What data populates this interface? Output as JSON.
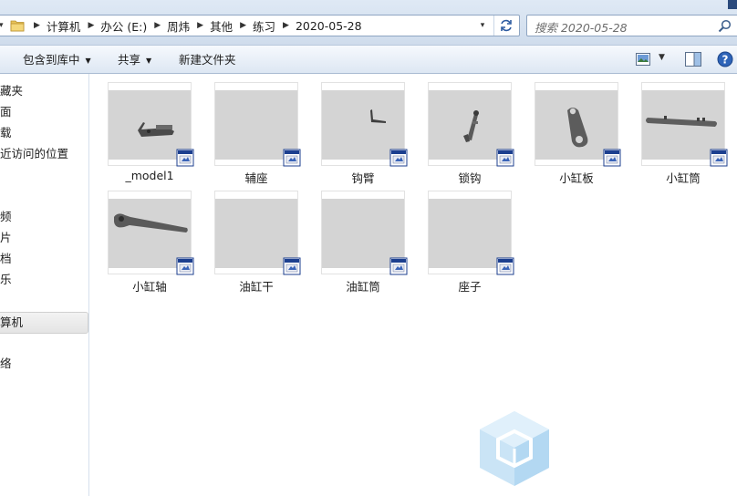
{
  "address_bar": {
    "crumbs": [
      "计算机",
      "办公 (E:)",
      "周炜",
      "其他",
      "练习",
      "2020-05-28"
    ]
  },
  "search": {
    "placeholder": "搜索 2020-05-28"
  },
  "toolbar": {
    "include_library": "包含到库中",
    "share": "共享",
    "new_folder": "新建文件夹"
  },
  "nav": {
    "items": [
      "藏夹",
      "面",
      "载",
      "近访问的位置",
      "频",
      "片",
      "档",
      "乐",
      "算机",
      "络"
    ]
  },
  "files": [
    {
      "name": "_model1",
      "art": "assembly"
    },
    {
      "name": "辅座",
      "art": "blank"
    },
    {
      "name": "钩臂",
      "art": "hook-arm"
    },
    {
      "name": "锁钩",
      "art": "lock-hook"
    },
    {
      "name": "小缸板",
      "art": "plate"
    },
    {
      "name": "小缸筒",
      "art": "cylinder"
    },
    {
      "name": "小缸轴",
      "art": "shaft"
    },
    {
      "name": "油缸干",
      "art": "blank"
    },
    {
      "name": "油缸筒",
      "art": "blank"
    },
    {
      "name": "座子",
      "art": "blank"
    }
  ],
  "colors": {
    "thumb_bg": "#d4d4d4",
    "selection": "#e4e4e4",
    "chrome": "#dfe9f5"
  }
}
